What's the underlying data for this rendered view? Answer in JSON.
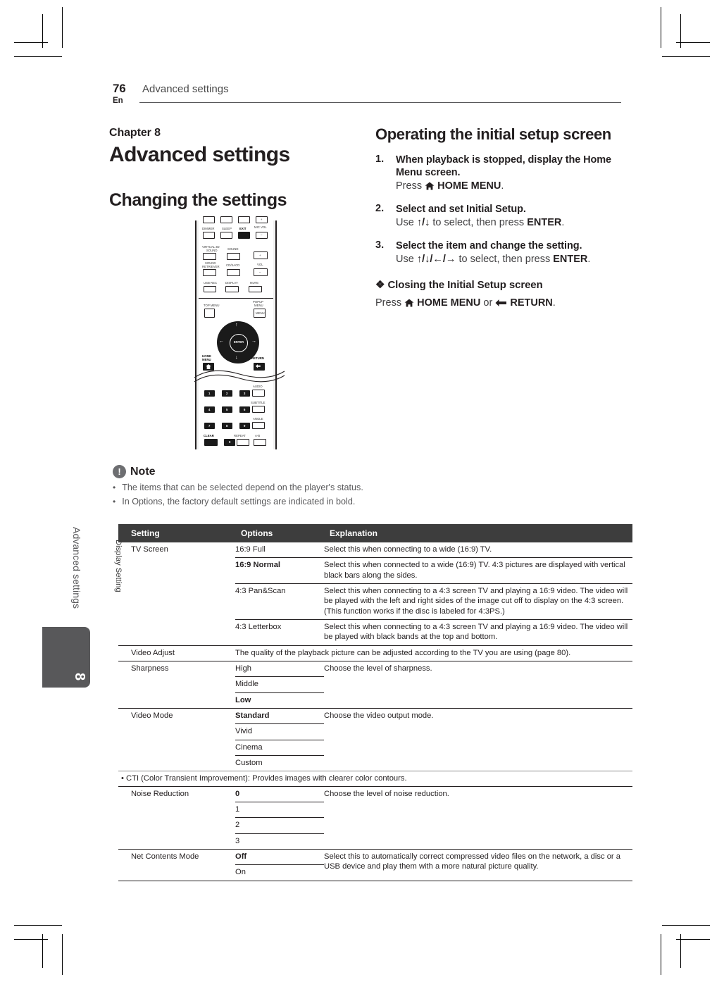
{
  "header": {
    "page_number": "76",
    "language": "En",
    "title": "Advanced settings"
  },
  "side_tab": {
    "text": "Advanced settings",
    "number": "8"
  },
  "left_column": {
    "chapter_label": "Chapter 8",
    "chapter_title": "Advanced settings",
    "section_title": "Changing the settings"
  },
  "remote": {
    "labels": {
      "dimmer": "DIMMER",
      "sleep": "SLEEP",
      "exit": "EXIT",
      "mic_vol": "MIC VOL",
      "virtual_3d_sound_1": "VIRTUAL 3D",
      "virtual_3d_sound_2": "SOUND",
      "sound": "SOUND",
      "sound_retriever_1": "SOUND",
      "sound_retriever_2": "RETRIEVER",
      "cd_sacd": "CD/SACD",
      "vol": "VOL",
      "usb_rec": "USB REC",
      "display": "DISPLAY",
      "mute": "MUTE",
      "top_menu": "TOP MENU",
      "popup_menu_1": "POPUP",
      "popup_menu_2": "MENU",
      "popup_menu_btn": "MENU",
      "enter": "ENTER",
      "home_menu_1": "HOME",
      "home_menu_2": "MENU",
      "return": "RETURN",
      "audio": "AUDIO",
      "subtitle": "SUBTITLE",
      "angle": "ANGLE",
      "clear": "CLEAR",
      "repeat": "REPEAT",
      "ab": "A-B",
      "plus": "+",
      "minus": "–",
      "num1": "1",
      "num2": "2",
      "num3": "3",
      "num4": "4",
      "num5": "5",
      "num6": "6",
      "num7": "7",
      "num8": "8",
      "num9": "9",
      "num0": "0"
    }
  },
  "right_column": {
    "title": "Operating the initial setup screen",
    "steps": [
      {
        "num": "1.",
        "head": "When playback is stopped, display the Home Menu screen.",
        "sub_pre": "Press ",
        "sub_icon": "home-icon",
        "sub_key": "HOME MENU",
        "sub_post": "."
      },
      {
        "num": "2.",
        "head": "Select and set Initial Setup.",
        "sub_pre": "Use ",
        "sub_arrows": "↑/↓",
        "sub_mid": " to select, then press ",
        "sub_key": "ENTER",
        "sub_post": "."
      },
      {
        "num": "3.",
        "head": "Select the item and change the setting.",
        "sub_pre": "Use ",
        "sub_arrows": "↑/↓/←/→",
        "sub_mid": " to select, then press ",
        "sub_key": "ENTER",
        "sub_post": "."
      }
    ],
    "closing": {
      "marker": "❖",
      "head": "Closing the Initial Setup screen",
      "sub_pre": "Press ",
      "key1": "HOME MENU",
      "sub_mid": " or ",
      "key2": "RETURN",
      "sub_post": "."
    }
  },
  "note": {
    "icon": "!",
    "label": "Note",
    "bullet": "•",
    "items": [
      "The items that can be selected depend on the player's status.",
      "In Options, the factory default settings are indicated in bold."
    ]
  },
  "table": {
    "vertical_label": "Display Setting",
    "columns": [
      "Setting",
      "Options",
      "Explanation"
    ],
    "rows": [
      {
        "setting": "TV Screen",
        "options": [
          {
            "label": "16:9 Full",
            "bold": false,
            "explanation": "Select this when connecting to a wide (16:9) TV."
          },
          {
            "label": "16:9 Normal",
            "bold": true,
            "explanation": "Select this when connected to a wide (16:9) TV. 4:3 pictures are displayed with vertical black bars along the sides."
          },
          {
            "label": "4:3 Pan&Scan",
            "bold": false,
            "explanation": "Select this when connecting to a 4:3 screen TV and playing a 16:9 video. The video will be played with the left and right sides of the image cut off to display on the 4:3 screen. (This function works if the disc is labeled for 4:3PS.)"
          },
          {
            "label": "4:3 Letterbox",
            "bold": false,
            "explanation": "Select this when connecting to a 4:3 screen TV and playing a 16:9 video. The video will be played with black bands at the top and bottom."
          }
        ]
      },
      {
        "setting": "Video Adjust",
        "span_explanation": "The quality of the playback picture can be adjusted according to the TV you are using (page 80)."
      },
      {
        "setting": "Sharpness",
        "explanation": "Choose the level of sharpness.",
        "options": [
          {
            "label": "High",
            "bold": false
          },
          {
            "label": "Middle",
            "bold": false
          },
          {
            "label": "Low",
            "bold": true
          }
        ]
      },
      {
        "setting": "Video Mode",
        "explanation": "Choose the video output mode.",
        "options": [
          {
            "label": "Standard",
            "bold": true
          },
          {
            "label": "Vivid",
            "bold": false
          },
          {
            "label": "Cinema",
            "bold": false
          },
          {
            "label": "Custom",
            "bold": false
          }
        ]
      },
      {
        "footnote": "• CTI (Color Transient Improvement): Provides images with clearer color contours."
      },
      {
        "setting": "Noise Reduction",
        "explanation": "Choose the level of noise reduction.",
        "options": [
          {
            "label": "0",
            "bold": true
          },
          {
            "label": "1",
            "bold": false
          },
          {
            "label": "2",
            "bold": false
          },
          {
            "label": "3",
            "bold": false
          }
        ]
      },
      {
        "setting": "Net Contents Mode",
        "explanation": "Select this to automatically correct compressed video files on the network, a disc or a USB device and play them with a more natural picture quality.",
        "options": [
          {
            "label": "Off",
            "bold": true
          },
          {
            "label": "On",
            "bold": false
          }
        ]
      }
    ]
  }
}
